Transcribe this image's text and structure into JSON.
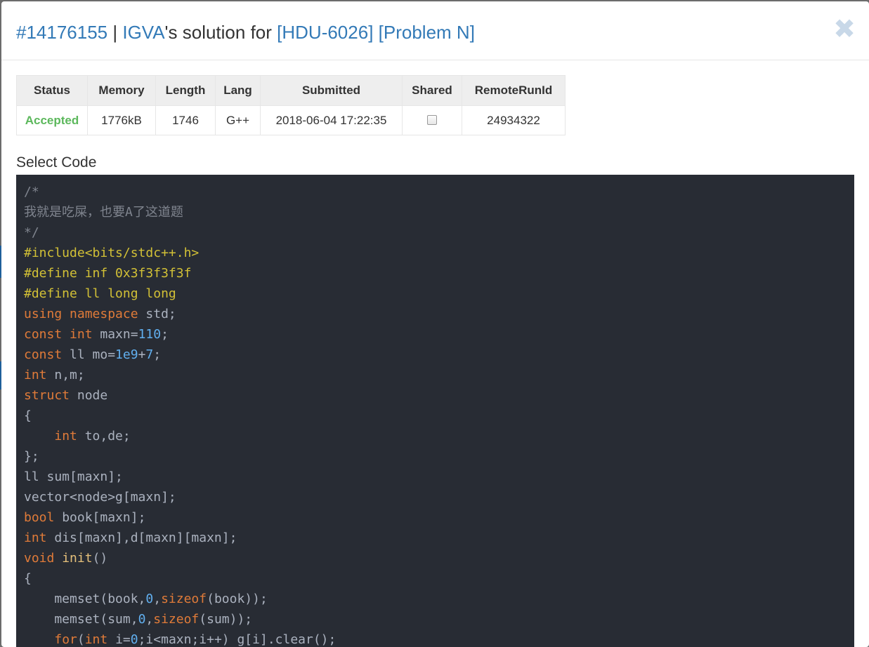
{
  "header": {
    "submission_id": "#14176155",
    "separator": " | ",
    "user": "IGVA",
    "solution_for_text": "'s solution for ",
    "problem_code": "[HDU-6026]",
    "problem_name": "[Problem N]",
    "close_glyph": "✖"
  },
  "table": {
    "headers": [
      "Status",
      "Memory",
      "Length",
      "Lang",
      "Submitted",
      "Shared",
      "RemoteRunId"
    ],
    "row": {
      "status": "Accepted",
      "memory": "1776kB",
      "length": "1746",
      "lang": "G++",
      "submitted": "2018-06-04 17:22:35",
      "shared": false,
      "remote_run_id": "24934322"
    }
  },
  "code_label": "Select Code",
  "colors": {
    "link": "#337ab7",
    "accepted": "#5cb85c",
    "code_bg": "#282c34",
    "comment": "#7f848e",
    "preprocessor": "#d2c036",
    "keyword": "#e07b39",
    "number": "#61afef",
    "plain": "#abb2bf"
  },
  "code_lines": [
    [
      [
        "c",
        "/*"
      ]
    ],
    [
      [
        "c",
        "我就是吃屎，也要A了这道题"
      ]
    ],
    [
      [
        "c",
        "*/"
      ]
    ],
    [
      [
        "p",
        "#include<bits/stdc++.h>"
      ]
    ],
    [
      [
        "p",
        "#define inf 0x3f3f3f3f"
      ]
    ],
    [
      [
        "p",
        "#define ll long long"
      ]
    ],
    [
      [
        "k",
        "using"
      ],
      [
        "t",
        " "
      ],
      [
        "k",
        "namespace"
      ],
      [
        "t",
        " std;"
      ]
    ],
    [
      [
        "k",
        "const"
      ],
      [
        "t",
        " "
      ],
      [
        "k",
        "int"
      ],
      [
        "t",
        " maxn="
      ],
      [
        "n",
        "110"
      ],
      [
        "t",
        ";"
      ]
    ],
    [
      [
        "k",
        "const"
      ],
      [
        "t",
        " ll mo="
      ],
      [
        "n",
        "1e9"
      ],
      [
        "t",
        "+"
      ],
      [
        "n",
        "7"
      ],
      [
        "t",
        ";"
      ]
    ],
    [
      [
        "k",
        "int"
      ],
      [
        "t",
        " n,m;"
      ]
    ],
    [
      [
        "k",
        "struct"
      ],
      [
        "t",
        " node"
      ]
    ],
    [
      [
        "t",
        "{"
      ]
    ],
    [
      [
        "t",
        "    "
      ],
      [
        "k",
        "int"
      ],
      [
        "t",
        " to,de;"
      ]
    ],
    [
      [
        "t",
        "};"
      ]
    ],
    [
      [
        "t",
        "ll sum[maxn];"
      ]
    ],
    [
      [
        "t",
        "vector<node>g[maxn];"
      ]
    ],
    [
      [
        "k",
        "bool"
      ],
      [
        "t",
        " book[maxn];"
      ]
    ],
    [
      [
        "k",
        "int"
      ],
      [
        "t",
        " dis[maxn],d[maxn][maxn];"
      ]
    ],
    [
      [
        "k",
        "void"
      ],
      [
        "t",
        " "
      ],
      [
        "f",
        "init"
      ],
      [
        "t",
        "()"
      ]
    ],
    [
      [
        "t",
        "{"
      ]
    ],
    [
      [
        "t",
        "    memset(book,"
      ],
      [
        "n",
        "0"
      ],
      [
        "t",
        ","
      ],
      [
        "k",
        "sizeof"
      ],
      [
        "t",
        "(book));"
      ]
    ],
    [
      [
        "t",
        "    memset(sum,"
      ],
      [
        "n",
        "0"
      ],
      [
        "t",
        ","
      ],
      [
        "k",
        "sizeof"
      ],
      [
        "t",
        "(sum));"
      ]
    ],
    [
      [
        "t",
        "    "
      ],
      [
        "k",
        "for"
      ],
      [
        "t",
        "("
      ],
      [
        "k",
        "int"
      ],
      [
        "t",
        " i="
      ],
      [
        "n",
        "0"
      ],
      [
        "t",
        ";i<maxn;i++) g[i].clear();"
      ]
    ]
  ]
}
